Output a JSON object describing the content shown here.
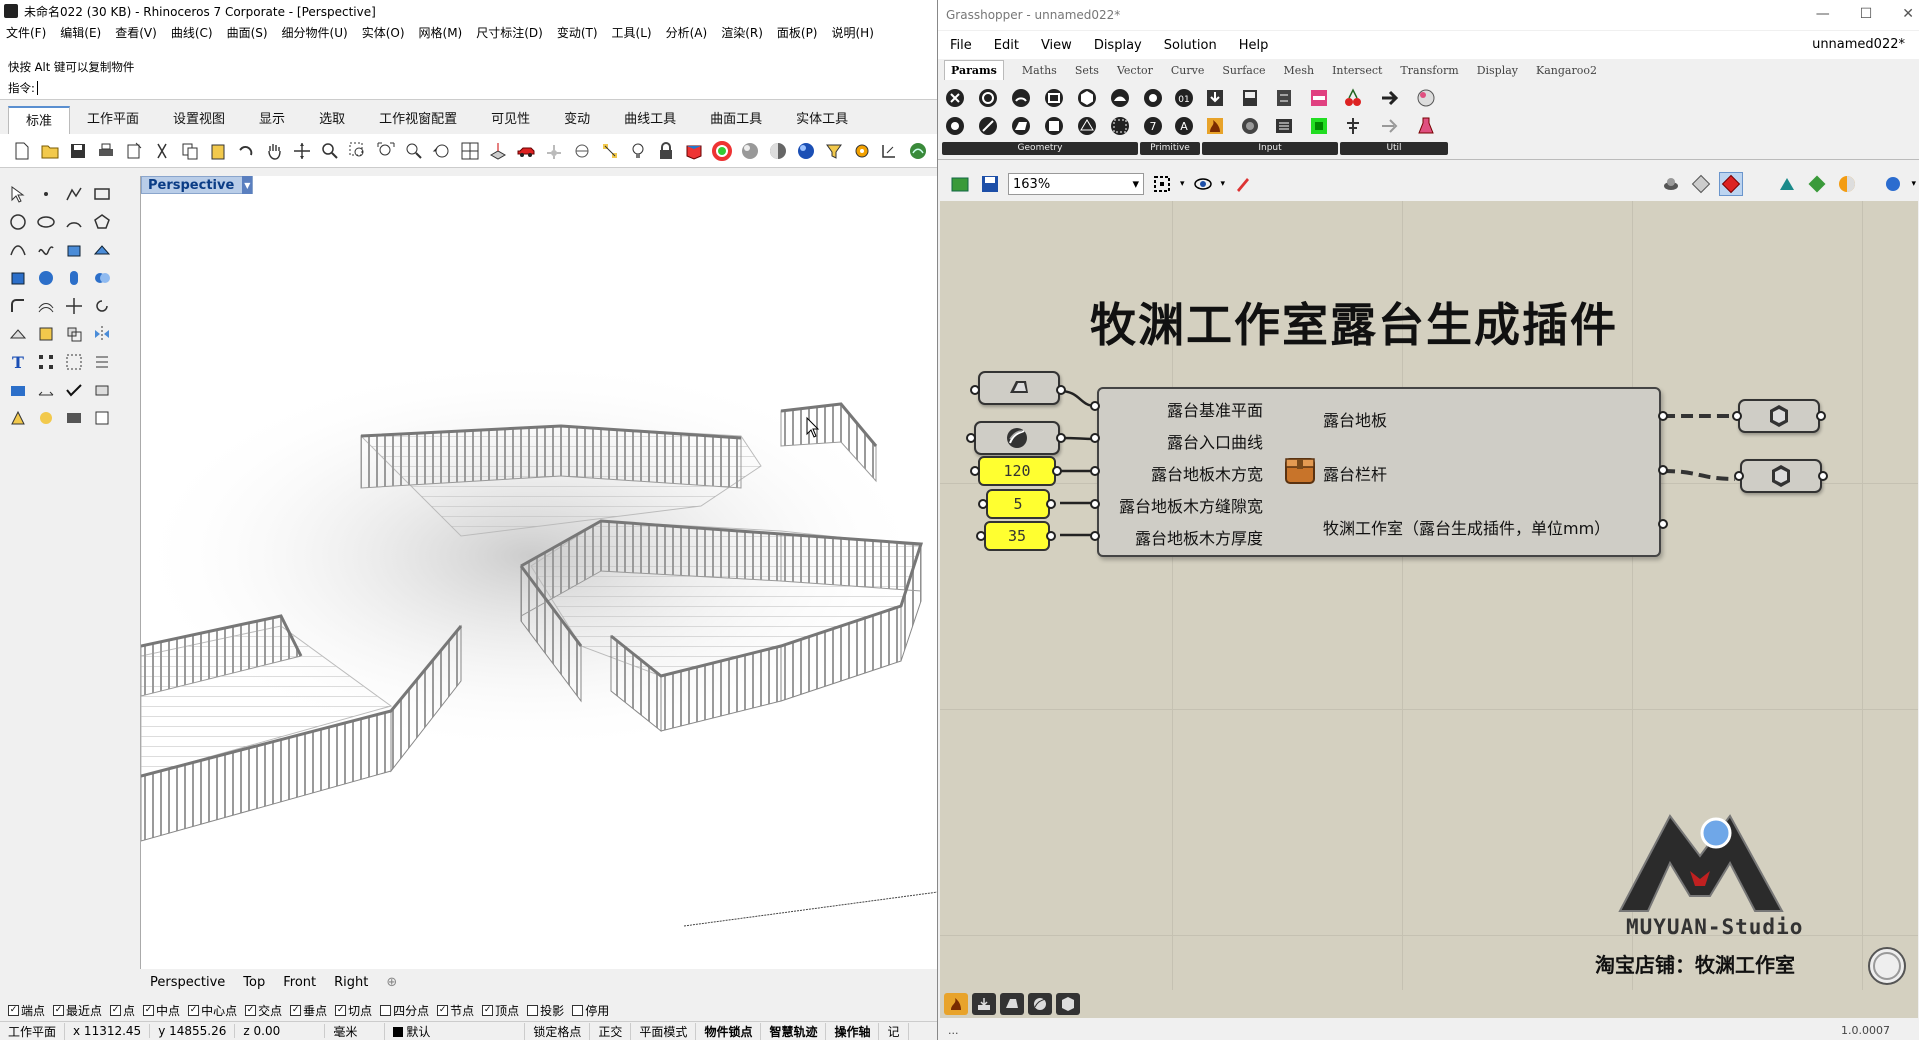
{
  "rhino": {
    "window_title": "未命名022 (30 KB) - Rhinoceros 7 Corporate - [Perspective]",
    "menu": [
      "文件(F)",
      "编辑(E)",
      "查看(V)",
      "曲线(C)",
      "曲面(S)",
      "细分物件(U)",
      "实体(O)",
      "网格(M)",
      "尺寸标注(D)",
      "变动(T)",
      "工具(L)",
      "分析(A)",
      "渲染(R)",
      "面板(P)",
      "说明(H)"
    ],
    "command_history_hint": "快按 Alt 键可以复制物件",
    "command_prompt_label": "指令:",
    "command_input_value": "",
    "toolbar_tabs": [
      "标准",
      "工作平面",
      "设置视图",
      "显示",
      "选取",
      "工作视窗配置",
      "可见性",
      "变动",
      "曲线工具",
      "曲面工具",
      "实体工具"
    ],
    "active_tab": "标准",
    "viewport": {
      "label": "Perspective",
      "tabs": [
        "Perspective",
        "Top",
        "Front",
        "Right"
      ]
    },
    "osnaps": [
      {
        "label": "端点",
        "checked": true
      },
      {
        "label": "最近点",
        "checked": true
      },
      {
        "label": "点",
        "checked": true
      },
      {
        "label": "中点",
        "checked": true
      },
      {
        "label": "中心点",
        "checked": true
      },
      {
        "label": "交点",
        "checked": true
      },
      {
        "label": "垂点",
        "checked": true
      },
      {
        "label": "切点",
        "checked": true
      },
      {
        "label": "四分点",
        "checked": false
      },
      {
        "label": "节点",
        "checked": true
      },
      {
        "label": "顶点",
        "checked": true
      },
      {
        "label": "投影",
        "checked": false
      },
      {
        "label": "停用",
        "checked": false
      }
    ],
    "status": {
      "cplane": "工作平面",
      "x": "x 11312.45",
      "y": "y 14855.26",
      "z": "z 0.00",
      "unit": "毫米",
      "layer": "默认",
      "items": [
        "锁定格点",
        "正交",
        "平面模式",
        "物件锁点",
        "智慧轨迹",
        "操作轴",
        "记"
      ]
    }
  },
  "grasshopper": {
    "window_title": "Grasshopper - unnamed022*",
    "menu": [
      "File",
      "Edit",
      "View",
      "Display",
      "Solution",
      "Help"
    ],
    "document_name": "unnamed022*",
    "tabs": [
      "Params",
      "Maths",
      "Sets",
      "Vector",
      "Curve",
      "Surface",
      "Mesh",
      "Intersect",
      "Transform",
      "Display",
      "Kangaroo2"
    ],
    "active_tab": "Params",
    "ribbon_groups": [
      "Geometry",
      "Primitive",
      "Input",
      "Util"
    ],
    "zoom": "163%",
    "group_title": "牧渊工作室露台生成插件",
    "component": {
      "inputs": [
        "露台基准平面",
        "露台入口曲线",
        "露台地板木方宽",
        "露台地板木方缝隙宽",
        "露台地板木方厚度"
      ],
      "outputs": [
        "露台地板",
        "露台栏杆",
        "牧渊工作室（露台生成插件，单位mm）"
      ]
    },
    "sliders": [
      "120",
      "5",
      "35"
    ],
    "logo_text": "MUYUAN-Studio",
    "shop_text": "淘宝店铺：牧渊工作室",
    "version": "1.0.0007",
    "status_left": "..."
  }
}
